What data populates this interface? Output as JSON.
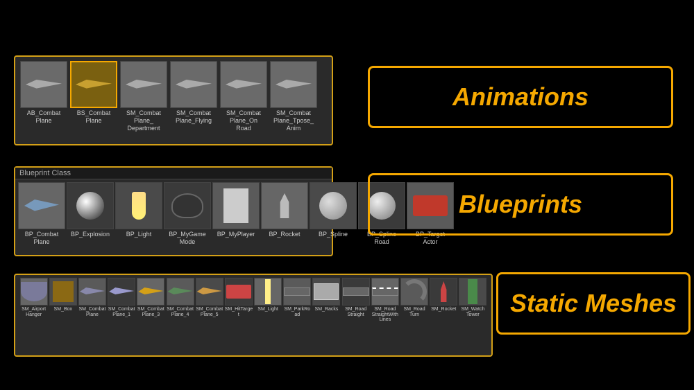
{
  "animations": {
    "label": "Animations",
    "items": [
      {
        "name": "AB_Combat\nPlane",
        "selected": false
      },
      {
        "name": "BS_Combat\nPlane",
        "selected": true
      },
      {
        "name": "SM_Combat\nPlane_\nDepartment",
        "selected": false
      },
      {
        "name": "SM_Combat\nPlane_Flying",
        "selected": false
      },
      {
        "name": "SM_Combat\nPlane_On\nRoad",
        "selected": false
      },
      {
        "name": "SM_Combat\nPlane_Tpose_\nAnim",
        "selected": false
      }
    ]
  },
  "blueprints": {
    "header": "Blueprint Class",
    "label": "Blueprints",
    "items": [
      {
        "name": "BP_Combat\nPlane"
      },
      {
        "name": "BP_Explosion"
      },
      {
        "name": "BP_Light"
      },
      {
        "name": "BP_MyGame\nMode"
      },
      {
        "name": "BP_MyPlayer"
      },
      {
        "name": "BP_Rocket"
      },
      {
        "name": "BP_Spline"
      },
      {
        "name": "BP_Spline\nRoad"
      },
      {
        "name": "BP_Target\nActor"
      }
    ]
  },
  "staticMeshes": {
    "label": "Static Meshes",
    "items": [
      {
        "name": "SM_Airport\nHanger"
      },
      {
        "name": "SM_Box"
      },
      {
        "name": "SM_Combat\nPlane"
      },
      {
        "name": "SM_Combat\nPlane_1"
      },
      {
        "name": "SM_Combat\nPlane_3"
      },
      {
        "name": "SM_Combat\nPlane_4"
      },
      {
        "name": "SM_Combat\nPlane_5"
      },
      {
        "name": "SM_HitTarget"
      },
      {
        "name": "SM_Light"
      },
      {
        "name": "SM_ParkRoad"
      },
      {
        "name": "SM_Racks"
      },
      {
        "name": "SM_Road\nStraight"
      },
      {
        "name": "SM_Road\nStraightWith\nLines"
      },
      {
        "name": "SM_Road\nTurn"
      },
      {
        "name": "SM_Rocket"
      },
      {
        "name": "SM_Watch\nTower"
      }
    ]
  }
}
